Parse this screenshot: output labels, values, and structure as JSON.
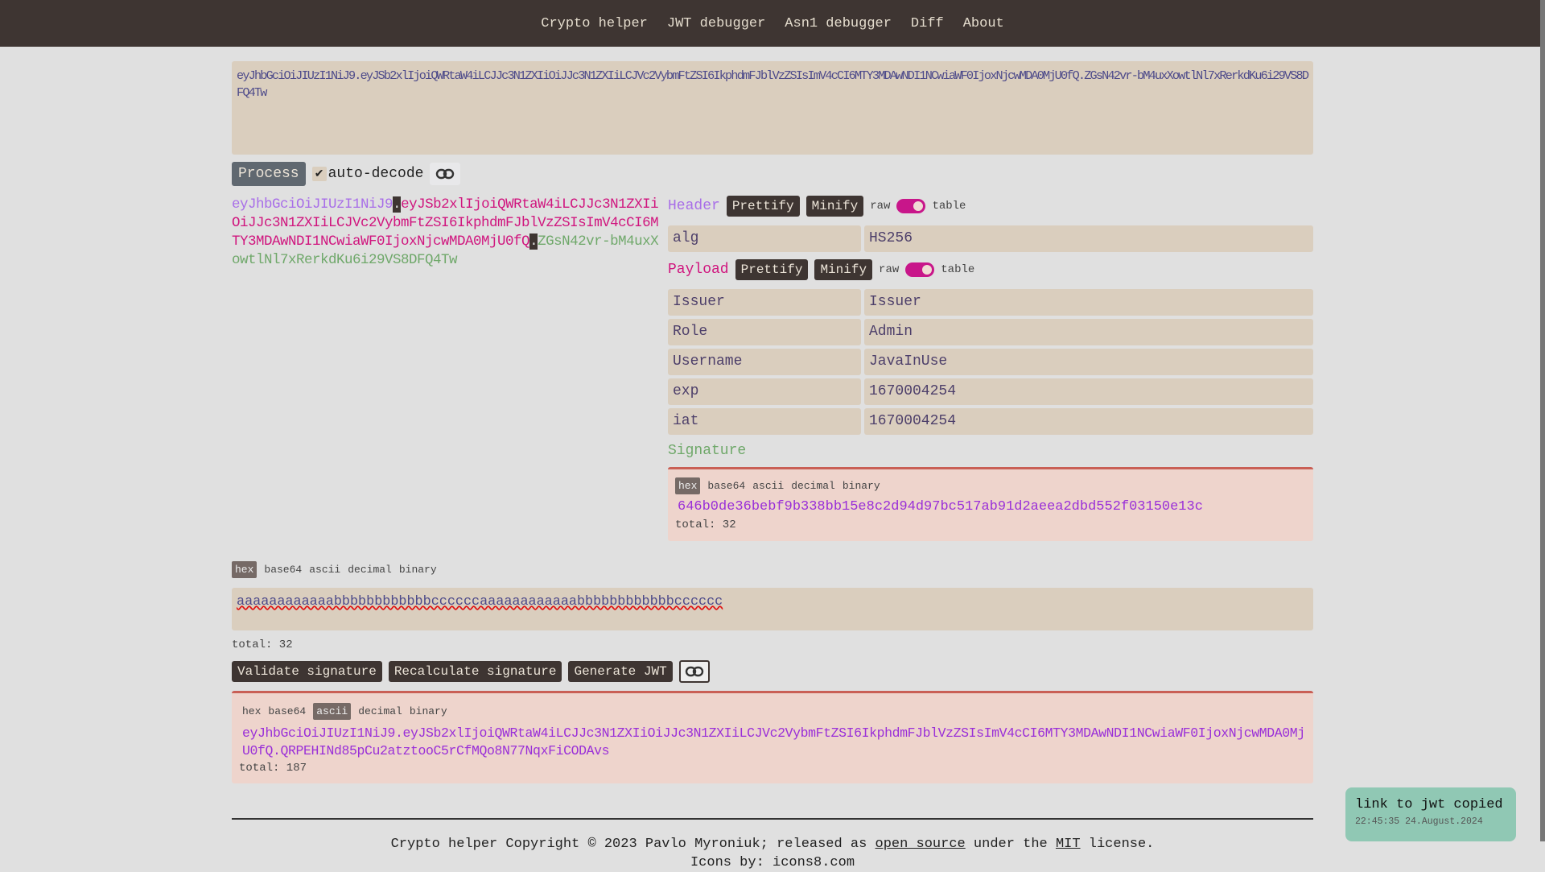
{
  "nav": [
    "Crypto helper",
    "JWT debugger",
    "Asn1 debugger",
    "Diff",
    "About"
  ],
  "jwt_input": "eyJhbGciOiJIUzI1NiJ9.eyJSb2xlIjoiQWRtaW4iLCJJc3N1ZXIiOiJJc3N1ZXIiLCJVc2VybmFtZSI6IkphdmFJblVzZSIsImV4cCI6MTY3MDAwNDI1NCwiaWF0IjoxNjcwMDA0MjU0fQ.ZGsN42vr-bM4uxXowtlNl7xRerkdKu6i29VS8DFQ4Tw",
  "process_label": "Process",
  "auto_decode_label": "auto-decode",
  "auto_decode_checked": true,
  "colored": {
    "header": "eyJhbGciOiJIUzI1NiJ9",
    "dot": ".",
    "payload": "eyJSb2xlIjoiQWRtaW4iLCJJc3N1ZXIiOiJJc3N1ZXIiLCJVc2VybmFtZSI6IkphdmFJblVzZSIsImV4cCI6MTY3MDAwNDI1NCwiaWF0IjoxNjcwMDA0MjU0fQ",
    "signature": "ZGsN42vr-bM4uxXowtlNl7xRerkdKu6i29VS8DFQ4Tw"
  },
  "header": {
    "title": "Header",
    "prettify": "Prettify",
    "minify": "Minify",
    "raw": "raw",
    "table": "table",
    "rows": [
      {
        "k": "alg",
        "v": "HS256"
      }
    ]
  },
  "payload": {
    "title": "Payload",
    "prettify": "Prettify",
    "minify": "Minify",
    "raw": "raw",
    "table": "table",
    "rows": [
      {
        "k": "Issuer",
        "v": "Issuer"
      },
      {
        "k": "Role",
        "v": "Admin"
      },
      {
        "k": "Username",
        "v": "JavaInUse"
      },
      {
        "k": "exp",
        "v": "1670004254"
      },
      {
        "k": "iat",
        "v": "1670004254"
      }
    ]
  },
  "signature": {
    "title": "Signature",
    "tabs": [
      "hex",
      "base64",
      "ascii",
      "decimal",
      "binary"
    ],
    "active": "hex",
    "value": "646b0de36bebf9b338bb15e8c2d94d97bc517ab91d2aeea2dbd552f03150e13c",
    "total": "total: 32"
  },
  "secret": {
    "tabs": [
      "hex",
      "base64",
      "ascii",
      "decimal",
      "binary"
    ],
    "active": "hex",
    "value": "aaaaaaaaaaaabbbbbbbbbbbbccccccaaaaaaaaaaaabbbbbbbbbbbbcccccc",
    "total": "total: 32"
  },
  "actions": {
    "validate": "Validate signature",
    "recalc": "Recalculate signature",
    "generate": "Generate JWT"
  },
  "result": {
    "tabs": [
      "hex",
      "base64",
      "ascii",
      "decimal",
      "binary"
    ],
    "active": "ascii",
    "value": "eyJhbGciOiJIUzI1NiJ9.eyJSb2xlIjoiQWRtaW4iLCJJc3N1ZXIiOiJJc3N1ZXIiLCJVc2VybmFtZSI6IkphdmFJblVzZSIsImV4cCI6MTY3MDAwNDI1NCwiaWF0IjoxNjcwMDA0MjU0fQ.QRPEHINd85pCu2atztooC5rCfMQo8N77NqxFiCODAvs",
    "total": "total: 187"
  },
  "footer": {
    "pre": "Crypto helper Copyright © 2023 Pavlo Myroniuk; released as ",
    "open_source": "open source",
    "mid": " under the ",
    "mit": "MIT",
    "post": " license.",
    "icons_pre": "Icons by: ",
    "icons_link": "icons8.com"
  },
  "toast": {
    "message": "link to jwt copied",
    "time": "22:45:35 24.August.2024"
  },
  "colors": {
    "header": "#a86ee8",
    "payload": "#d0157e",
    "signature": "#6fa86a",
    "accent": "#c8168a"
  }
}
